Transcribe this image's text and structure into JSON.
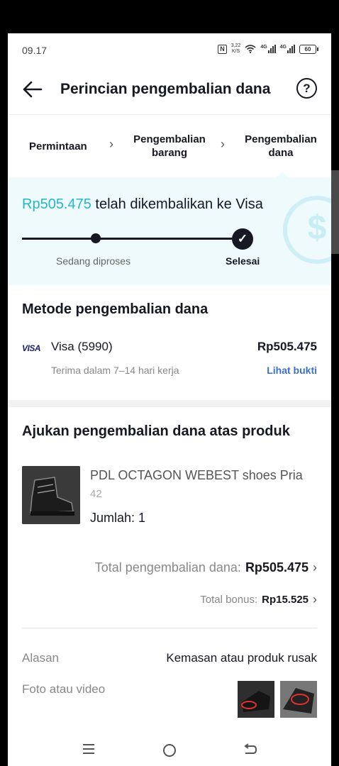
{
  "status_bar": {
    "time": "09.17",
    "speed_value": "3,22",
    "speed_unit": "K/S",
    "net1": "4G",
    "net2": "4G",
    "battery": "60"
  },
  "header": {
    "title": "Perincian pengembalian dana",
    "help_glyph": "?"
  },
  "steps": {
    "step1": "Permintaan",
    "step2": "Pengembalian barang",
    "step3": "Pengembalian dana",
    "separator": "›"
  },
  "refund_status": {
    "amount": "Rp505.475",
    "text": " telah dikembalikan ke Visa",
    "progress_labels": [
      "Sedang diproses",
      "Selesai"
    ],
    "done_glyph": "✓"
  },
  "method": {
    "title": "Metode pengembalian dana",
    "card_logo": "VISA",
    "card_name": "Visa (5990)",
    "amount": "Rp505.475",
    "eta": "Terima dalam 7–14 hari kerja",
    "proof_link": "Lihat bukti"
  },
  "product": {
    "section_title": "Ajukan pengembalian dana atas produk",
    "name": "PDL OCTAGON WEBEST shoes Pria",
    "variant": "42",
    "quantity": "Jumlah: 1"
  },
  "totals": {
    "refund_label": "Total pengembalian dana: ",
    "refund_amount": "Rp505.475",
    "bonus_label": "Total bonus: ",
    "bonus_amount": "Rp15.525",
    "arrow": "›"
  },
  "details": {
    "reason_label": "Alasan",
    "reason_value": "Kemasan atau produk rusak",
    "media_label": "Foto atau video"
  },
  "icons": {
    "back": "arrow-left-icon",
    "help": "question-circle-icon",
    "wifi": "wifi-icon",
    "nfc": "nfc-icon",
    "battery": "battery-icon",
    "menu": "menu-icon",
    "home": "home-icon",
    "recent": "back-nav-icon"
  },
  "colors": {
    "accent": "#25b7c9",
    "link": "#3a6fd0",
    "banner_bg": "#eefafc",
    "text": "#161823"
  }
}
